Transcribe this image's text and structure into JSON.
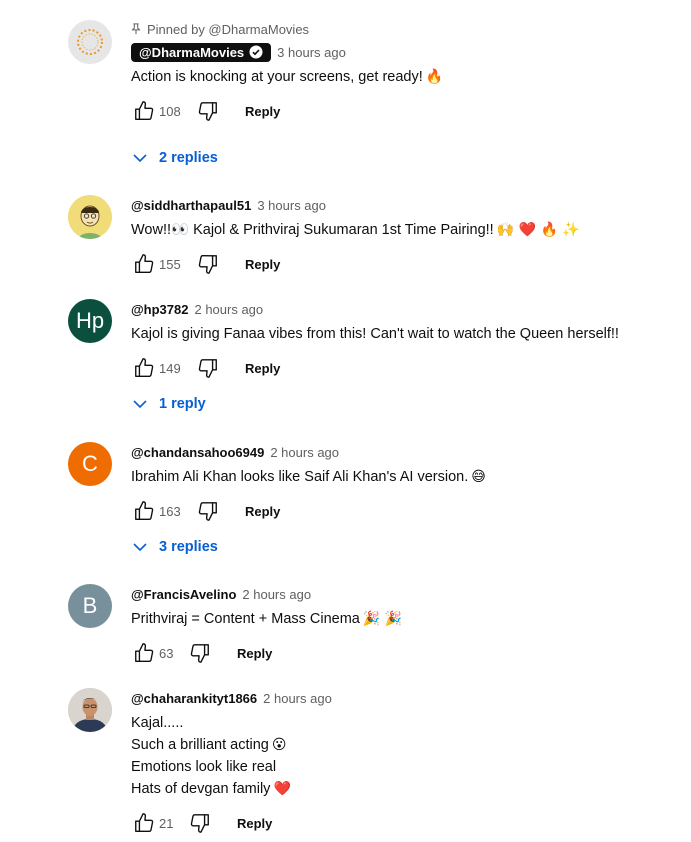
{
  "comments": [
    {
      "pinned_label": "Pinned by @DharmaMovies",
      "author": "@DharmaMovies",
      "time": "3 hours ago",
      "lines": [
        "Action is knocking at your screens, get ready!"
      ],
      "emoji_after": [
        "🔥"
      ],
      "likes": "108",
      "reply": "Reply",
      "replies": "2 replies",
      "avatar": {
        "letter": "",
        "color": "#e8e8e8",
        "icon": "dharma-logo-icon"
      }
    },
    {
      "author": "@siddharthapaul51",
      "time": "3 hours ago",
      "lines": [
        "Wow!!👀 Kajol & Prithviraj Sukumaran 1st Time Pairing!!"
      ],
      "emoji_after": [
        "🙌 ❤️ 🔥 ✨"
      ],
      "likes": "155",
      "reply": "Reply",
      "avatar": {
        "letter": "",
        "color": "#f4d56b",
        "icon": "cartoon-face-icon"
      }
    },
    {
      "author": "@hp3782",
      "time": "2 hours ago",
      "lines": [
        "Kajol is giving Fanaa vibes from this! Can't wait to watch the Queen herself!!"
      ],
      "likes": "149",
      "reply": "Reply",
      "replies": "1 reply",
      "avatar": {
        "letter": "Hp",
        "color": "#0b4f3f"
      }
    },
    {
      "author": "@chandansahoo6949",
      "time": "2 hours ago",
      "lines": [
        "Ibrahim Ali Khan looks like Saif Ali Khan's AI version."
      ],
      "emoji_after": [
        "😅"
      ],
      "likes": "163",
      "reply": "Reply",
      "replies": "3 replies",
      "avatar": {
        "letter": "C",
        "color": "#ef6c00"
      }
    },
    {
      "author": "@FrancisAvelino",
      "time": "2 hours ago",
      "lines": [
        "Prithviraj = Content + Mass Cinema"
      ],
      "emoji_after": [
        "🎉 🎉"
      ],
      "likes": "63",
      "reply": "Reply",
      "avatar": {
        "letter": "B",
        "color": "#78909c"
      }
    },
    {
      "author": "@chaharankityt1866",
      "time": "2 hours ago",
      "lines": [
        "Kajal.....",
        "Such a brilliant acting",
        "Emotions look like real",
        "Hats of devgan family"
      ],
      "line_emoji": [
        "",
        "😮",
        "",
        "❤️"
      ],
      "likes": "21",
      "reply": "Reply",
      "avatar": {
        "letter": "",
        "color": "#c9c3bd",
        "icon": "profile-photo-icon"
      }
    }
  ],
  "colors": {
    "link": "#065fd4",
    "secondary": "#606060",
    "text": "#0f0f0f",
    "fire": "#f4511e",
    "heart": "#e53935"
  }
}
